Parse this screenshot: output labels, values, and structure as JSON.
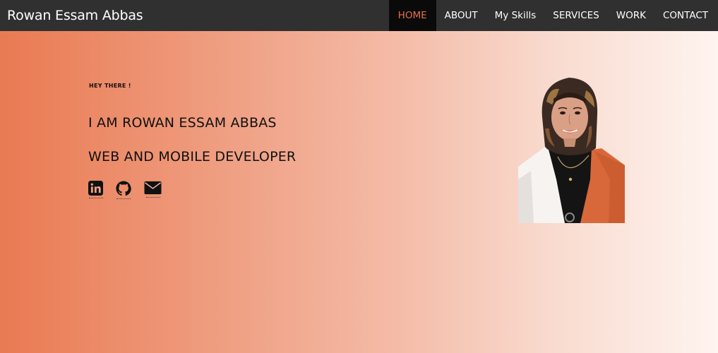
{
  "navbar": {
    "brand": "Rowan Essam Abbas",
    "links": [
      {
        "label": "HOME",
        "active": true
      },
      {
        "label": "ABOUT",
        "active": false
      },
      {
        "label": "My Skills",
        "active": false
      },
      {
        "label": "SERVICES",
        "active": false
      },
      {
        "label": "WORK",
        "active": false
      },
      {
        "label": "CONTACT",
        "active": false
      }
    ]
  },
  "hero": {
    "greeting": "HEY THERE !",
    "name_line": "I AM ROWAN ESSAM ABBAS",
    "role_line": "WEB AND MOBILE DEVELOPER",
    "socials": [
      {
        "icon": "linkedin-icon"
      },
      {
        "icon": "github-icon"
      },
      {
        "icon": "envelope-icon"
      }
    ]
  },
  "colors": {
    "navbar_bg": "#303030",
    "active_tab_bg": "#0a0a0a",
    "accent": "#e8704a",
    "gradient_start": "#e97a52",
    "gradient_end": "#fef4f0"
  }
}
